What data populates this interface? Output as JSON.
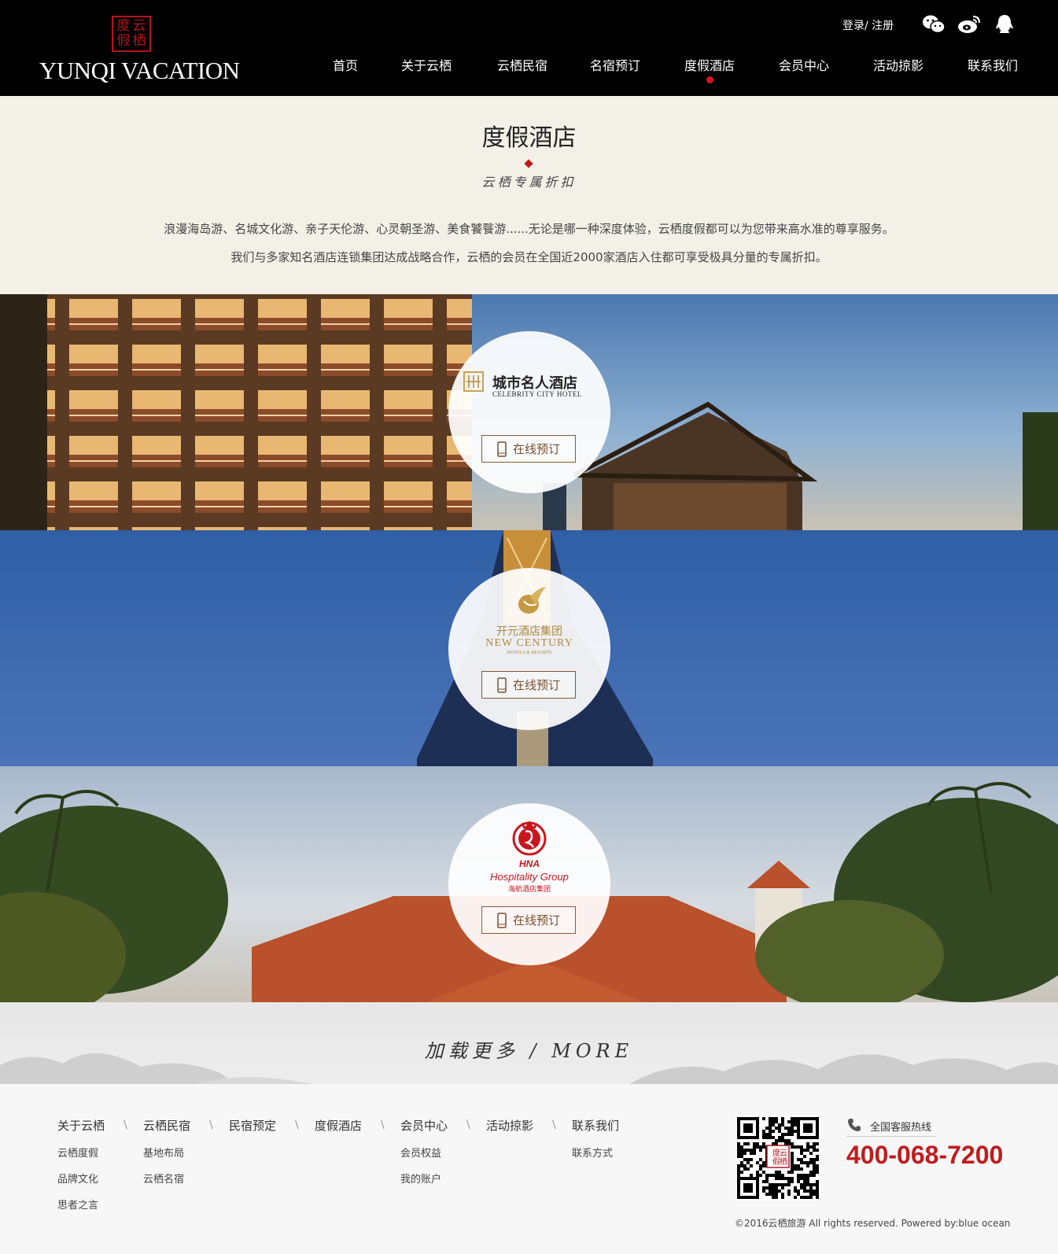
{
  "header": {
    "logo_seal_chars": [
      "度",
      "云",
      "假",
      "栖"
    ],
    "logo_text": "YUNQI VACATION",
    "login_label": "登录",
    "login_sep": "/",
    "register_label": "注册",
    "social_icons": [
      "wechat-icon",
      "weibo-icon",
      "qq-icon"
    ],
    "nav": [
      "首页",
      "关于云栖",
      "云栖民宿",
      "名宿预订",
      "度假酒店",
      "会员中心",
      "活动掠影",
      "联系我们"
    ],
    "active_nav_index": 4
  },
  "intro": {
    "title": "度假酒店",
    "subtitle": "云栖专属折扣",
    "paragraph1": "浪漫海岛游、名城文化游、亲子天伦游、心灵朝圣游、美食饕餮游......无论是哪一种深度体验，云栖度假都可以为您带来高水准的尊享服务。",
    "paragraph2": "我们与多家知名酒店连锁集团达成战略合作，云栖的会员在全国近2000家酒店入住都可享受极具分量的专属折扣。"
  },
  "hotels": [
    {
      "name_cn": "城市名人酒店",
      "name_en": "CELEBRITY CITY HOTEL",
      "book_label": "在线预订"
    },
    {
      "name_cn": "开元酒店集团",
      "name_en": "NEW CENTURY",
      "name_en_sub": "HOTELS & RESORTS",
      "book_label": "在线预订"
    },
    {
      "logo_mark": "HNA",
      "name_en": "Hospitality Group",
      "name_cn": "海航酒店集团",
      "book_label": "在线预订"
    }
  ],
  "more": {
    "label": "加载更多 / MORE"
  },
  "footer": {
    "columns": [
      {
        "title": "关于云栖",
        "links": [
          "云栖度假",
          "品牌文化",
          "思者之言"
        ]
      },
      {
        "title": "云栖民宿",
        "links": [
          "基地布局",
          "云栖名宿"
        ]
      },
      {
        "title": "民宿预定",
        "links": []
      },
      {
        "title": "度假酒店",
        "links": []
      },
      {
        "title": "会员中心",
        "links": [
          "会员权益",
          "我的账户"
        ]
      },
      {
        "title": "活动掠影",
        "links": []
      },
      {
        "title": "联系我们",
        "links": [
          "联系方式"
        ]
      }
    ],
    "separator": "\\",
    "qr_seal_chars": [
      "度",
      "云",
      "假",
      "栖"
    ],
    "hotline_label": "全国客服热线",
    "hotline_number": "400-068-7200",
    "copyright": "©2016云栖旅游 All rights reserved. Powered by:blue ocean"
  },
  "colors": {
    "header_bg": "#000000",
    "accent_red": "#c01b1e",
    "intro_bg": "#f3f0e7",
    "book_button": "#8b5a34"
  }
}
